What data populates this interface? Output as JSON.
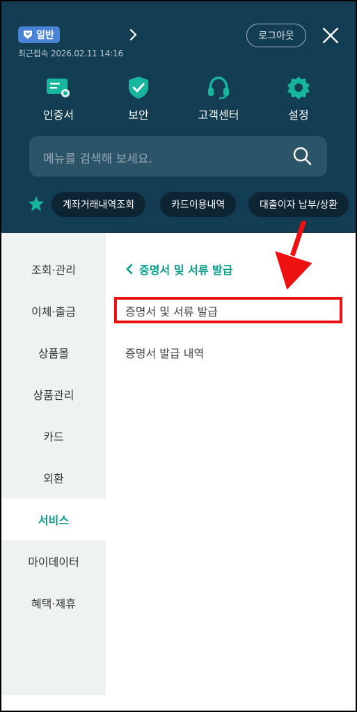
{
  "header": {
    "grade_badge": "일반",
    "last_login": "최근접속 2026.02.11 14:16",
    "logout_label": "로그아웃",
    "quick_menu": [
      {
        "label": "인증서",
        "icon": "certificate-icon"
      },
      {
        "label": "보안",
        "icon": "shield-check-icon"
      },
      {
        "label": "고객센터",
        "icon": "headset-icon"
      },
      {
        "label": "설정",
        "icon": "gear-icon"
      }
    ],
    "search_placeholder": "메뉴를 검색해 보세요.",
    "favorites": [
      "계좌거래내역조회",
      "카드이용내역",
      "대출이자 납부/상환"
    ]
  },
  "sidebar": {
    "items": [
      "조회·관리",
      "이체·출금",
      "상품몰",
      "상품관리",
      "카드",
      "외환",
      "서비스",
      "마이데이터",
      "혜택·제휴"
    ],
    "active": "서비스"
  },
  "content": {
    "back_title": "증명서 및 서류 발급",
    "items": [
      "증명서 및 서류 발급",
      "증명서 발급 내역"
    ]
  },
  "colors": {
    "header_bg": "#123d52",
    "accent": "#0a9d8c",
    "annotation_red": "#ee1111"
  }
}
